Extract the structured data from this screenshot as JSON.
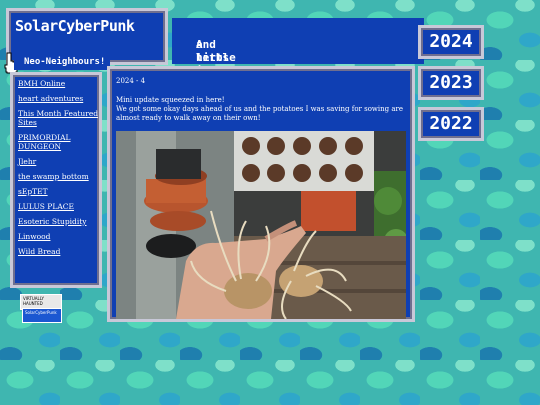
{
  "site": {
    "title": "SolarCyberPunk",
    "tagline_line1": "A little blog about growing crops",
    "tagline_line2": "and herbs in a small, city area!"
  },
  "years": [
    "2024",
    "2023",
    "2022"
  ],
  "sidebar": {
    "header": "Neo-Neighbours!",
    "links": [
      "BMH Online",
      "heart adventures",
      "This Month Featured Sites",
      "PRIMORDIAL DUNGEON",
      "Jlehr",
      "the swamp bottom",
      "sEpTET",
      "LULUS PLACE",
      "Esoteric Stupidity",
      "Linwood",
      "Wild Bread"
    ]
  },
  "badges": {
    "b1": "VIRTUALLY HAUNTED",
    "b2": "SolarCyberPunk"
  },
  "post": {
    "date": "2024 - 4",
    "line1": "Mini update squeezed in here!",
    "line2": "We got some okay days ahead of us and the potatoes I was saving for sowing are almost ready to walk away on their own!"
  },
  "colors": {
    "panel": "#0f3fb3",
    "frame": "#c8c8d8",
    "text": "#ffffff"
  }
}
